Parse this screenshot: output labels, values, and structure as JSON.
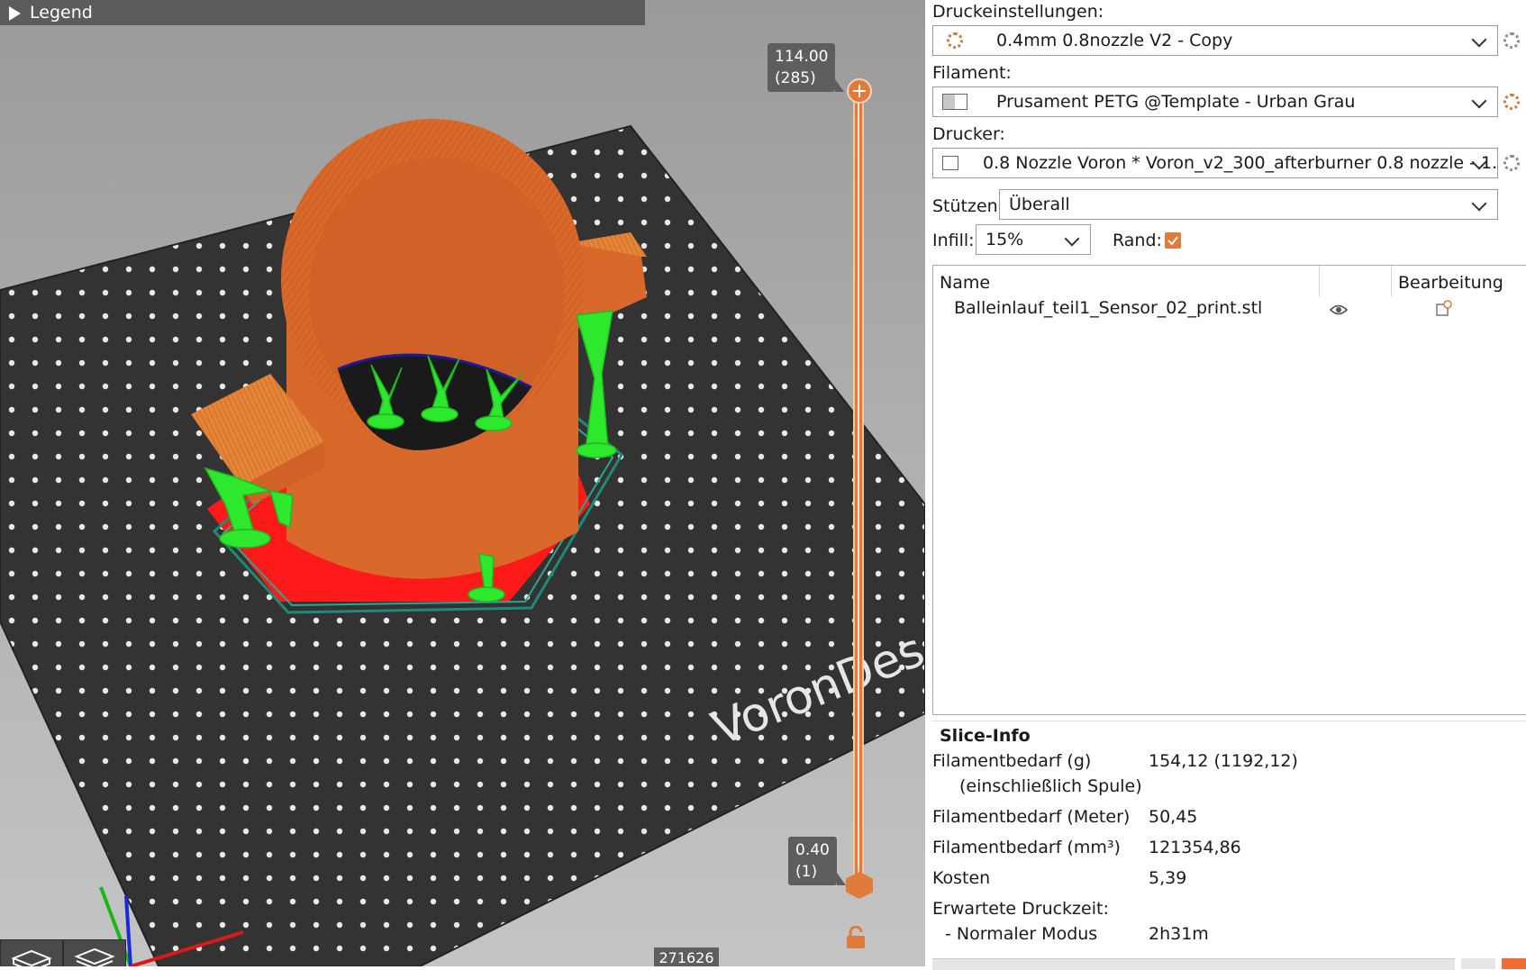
{
  "legend": {
    "label": "Legend"
  },
  "layer_slider": {
    "top_height": "114.00",
    "top_layer": "(285)",
    "bottom_height": "0.40",
    "bottom_layer": "(1)"
  },
  "bed_logo": "VoronDes",
  "move_counter": "271626",
  "sidebar": {
    "print_settings_label": "Druckeinstellungen:",
    "print_settings_value": "0.4mm 0.8nozzle V2 - Copy",
    "filament_label": "Filament:",
    "filament_value": "Prusament PETG @Template - Urban Grau",
    "printer_label": "Drucker:",
    "printer_value": "0.8 Nozzle Voron  * Voron_v2_300_afterburner 0.8 nozzle - 1. ...",
    "supports_label": "Stützen:",
    "supports_value": "Überall",
    "infill_label": "Infill:",
    "infill_value": "15%",
    "brim_label": "Rand:",
    "brim_checked": true
  },
  "object_list": {
    "col_name": "Name",
    "col_edit": "Bearbeitung",
    "items": [
      {
        "name": "Balleinlauf_teil1_Sensor_02_print.stl"
      }
    ]
  },
  "slice_info": {
    "title": "Slice-Info",
    "rows": [
      {
        "label": "Filamentbedarf (g)",
        "value": "154,12 (1192,12)"
      },
      {
        "label": "(einschließlich Spule)",
        "value": ""
      },
      {
        "label": "Filamentbedarf (Meter)",
        "value": "50,45"
      },
      {
        "label": "Filamentbedarf (mm³)",
        "value": "121354,86"
      },
      {
        "label": "Kosten",
        "value": "5,39"
      },
      {
        "label": "Erwartete Druckzeit:",
        "value": ""
      },
      {
        "label": "- Normaler Modus",
        "value": "2h31m"
      }
    ]
  },
  "colors": {
    "model": "#d9692b",
    "support": "#2ee82e",
    "first_layer": "#ff1a1a",
    "skirt": "#1e8a7a",
    "bed": "#333333",
    "accent": "#e07b39"
  }
}
